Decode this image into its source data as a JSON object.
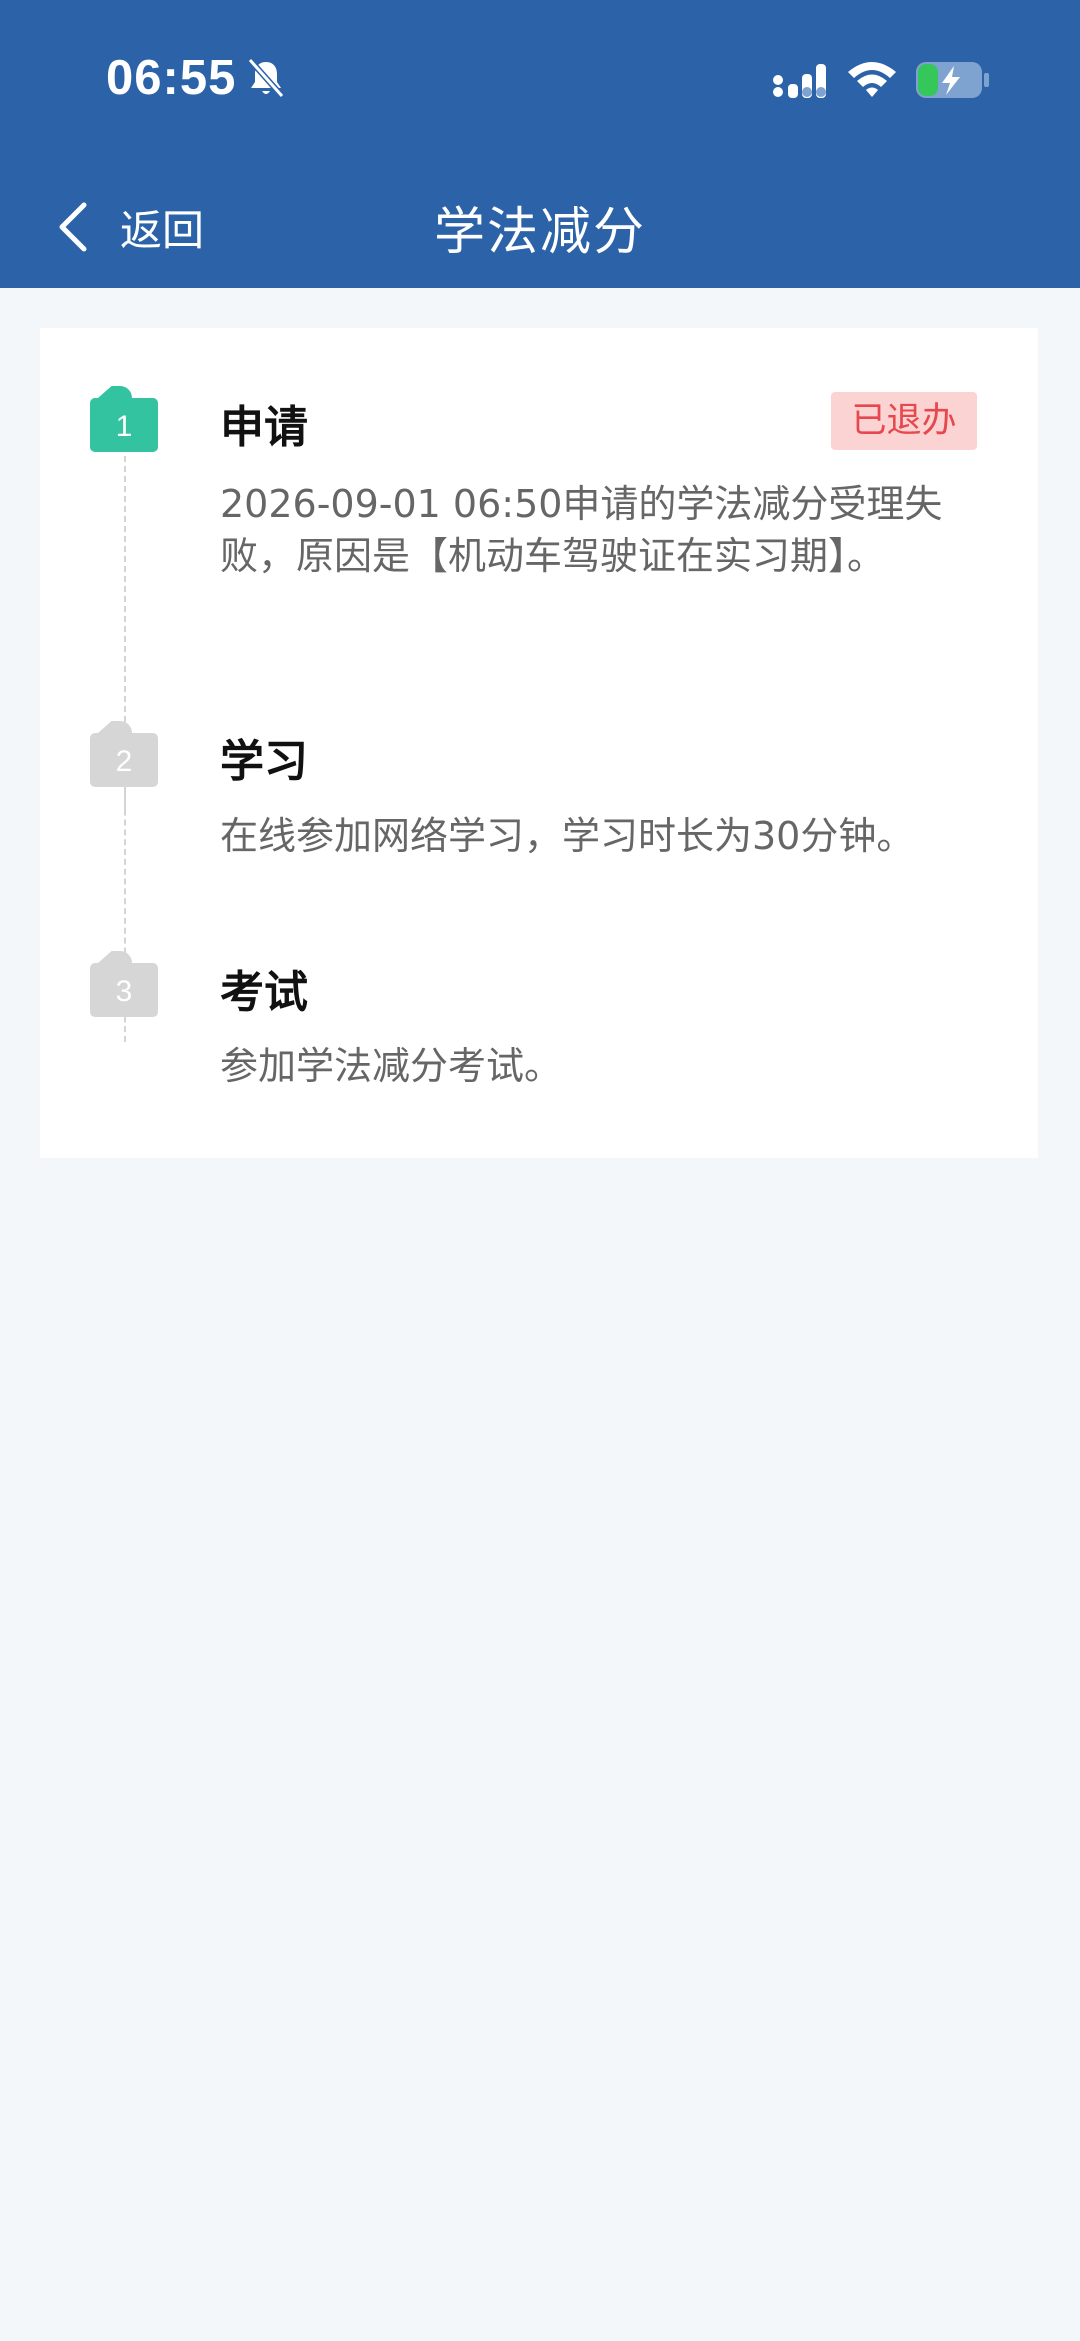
{
  "status_bar": {
    "time": "06:55",
    "icons": [
      "bell-slash-icon",
      "signal-icon",
      "wifi-icon",
      "battery-charging-icon"
    ]
  },
  "nav": {
    "back_label": "返回",
    "title": "学法减分"
  },
  "steps": [
    {
      "number": "1",
      "title": "申请",
      "status": "已退办",
      "description": "2026-09-01 06:50申请的学法减分受理失败，原因是【机动车驾驶证在实习期】。",
      "state": "active"
    },
    {
      "number": "2",
      "title": "学习",
      "description": "在线参加网络学习，学习时长为30分钟。",
      "state": "inactive"
    },
    {
      "number": "3",
      "title": "考试",
      "description": "参加学法减分考试。",
      "state": "inactive"
    }
  ],
  "colors": {
    "header_bg": "#2c63a8",
    "page_bg": "#f3f7f9",
    "active_step": "#33c3a0",
    "inactive_step": "#d6d6d6",
    "status_badge_bg": "#fcd3d3",
    "status_badge_text": "#e5484d"
  }
}
